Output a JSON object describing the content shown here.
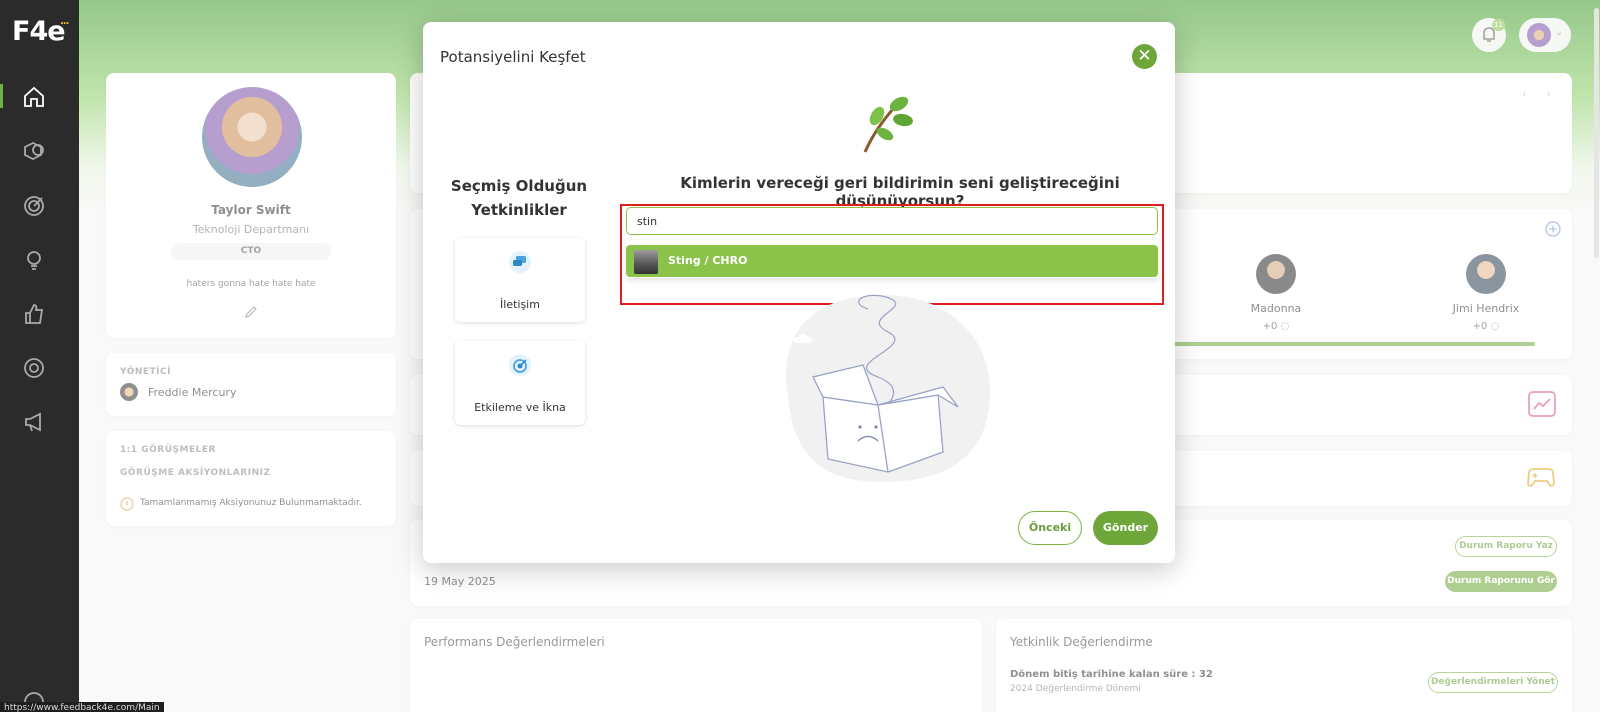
{
  "app": {
    "logo": "F4e",
    "logo_dots": "..."
  },
  "header": {
    "notification_count": "11"
  },
  "profile": {
    "name": "Taylor Swift",
    "department": "Teknoloji Departmanı",
    "role": "CTO",
    "motto": "haters gonna hate hate hate"
  },
  "manager": {
    "label": "YÖNETİCİ",
    "name": "Freddie Mercury"
  },
  "meetings": {
    "label": "1:1 GÖRÜŞMELER",
    "actions_label": "GÖRÜŞME AKSİYONLARINIZ",
    "info": "Tamamlanmamış Aksiyonunuz Bulunmamaktadır."
  },
  "team": [
    {
      "name": "Madonna",
      "score": "+0"
    },
    {
      "name": "Jimi Hendrix",
      "score": "+0"
    }
  ],
  "status_report": {
    "date": "19 May 2025",
    "write_label": "Durum Raporu Yaz",
    "view_label": "Durum Raporunu Gör"
  },
  "performance": {
    "title": "Performans Değerlendirmeleri"
  },
  "competency_eval": {
    "title": "Yetkinlik Değerlendirme",
    "remaining": "Dönem bitiş tarihine kalan süre : 32",
    "period": "2024 Değerlendirme Dönemi",
    "manage_label": "Değerlendirmeleri Yönet"
  },
  "modal": {
    "title": "Potansiyelini Keşfet",
    "left_heading": "Seçmiş Olduğun Yetkinlikler",
    "competencies": [
      {
        "label": "İletişim"
      },
      {
        "label": "Etkileme ve İkna"
      }
    ],
    "question": "Kimlerin vereceği geri bildirimin seni geliştireceğini düşünüyorsun?",
    "search_value": "stin",
    "suggestion": "Sting / CHRO",
    "prev_label": "Önceki",
    "send_label": "Gönder"
  },
  "status_url": "https://www.feedback4e.com/Main",
  "colors": {
    "accent": "#6ea63a",
    "accent_light": "#8bc34a",
    "highlight": "#e11d1d",
    "sidebar": "#2b2b2b"
  }
}
